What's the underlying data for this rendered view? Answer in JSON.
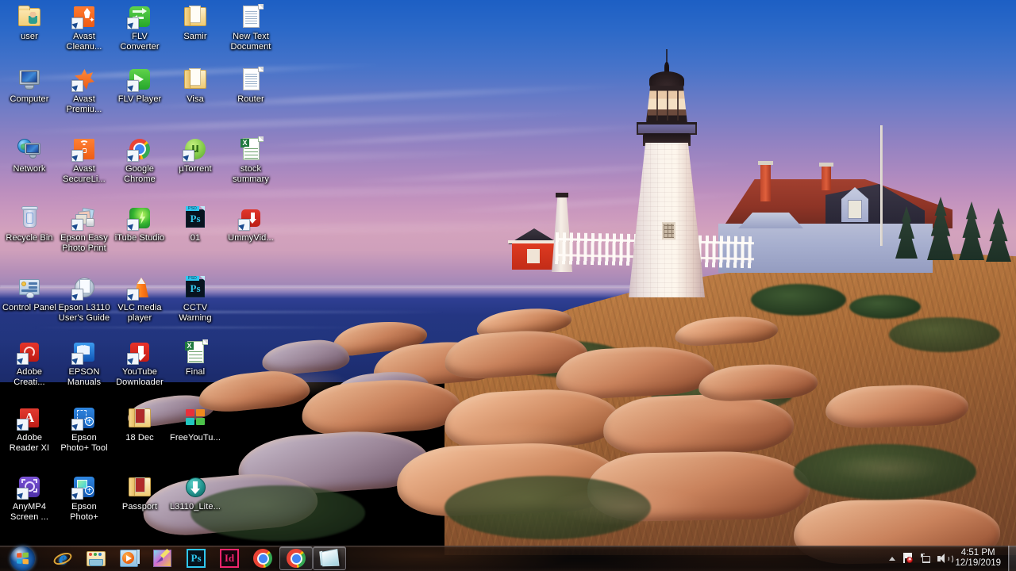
{
  "desktop": {
    "wallpaper_name": "pemaquid-point-lighthouse",
    "icons": [
      {
        "label": "user",
        "icon": "user-folder-icon",
        "col": 0,
        "row": 0
      },
      {
        "label": "Avast Cleanu...",
        "icon": "avast-cleanup-icon",
        "col": 1,
        "row": 0
      },
      {
        "label": "FLV Converter",
        "icon": "flv-converter-icon",
        "col": 2,
        "row": 0
      },
      {
        "label": "Samir",
        "icon": "folder-icon",
        "col": 3,
        "row": 0
      },
      {
        "label": "New Text Document",
        "icon": "text-document-icon",
        "col": 4,
        "row": 0
      },
      {
        "label": "Computer",
        "icon": "computer-icon",
        "col": 0,
        "row": 1
      },
      {
        "label": "Avast Premiu...",
        "icon": "avast-premium-icon",
        "col": 1,
        "row": 1
      },
      {
        "label": "FLV Player",
        "icon": "flv-player-icon",
        "col": 2,
        "row": 1
      },
      {
        "label": "Visa",
        "icon": "folder-icon",
        "col": 3,
        "row": 1
      },
      {
        "label": "Router",
        "icon": "text-document-icon",
        "col": 4,
        "row": 1
      },
      {
        "label": "Network",
        "icon": "network-icon",
        "col": 0,
        "row": 2
      },
      {
        "label": "Avast SecureLi...",
        "icon": "avast-secureline-icon",
        "col": 1,
        "row": 2
      },
      {
        "label": "Google Chrome",
        "icon": "google-chrome-icon",
        "col": 2,
        "row": 2
      },
      {
        "label": "µTorrent",
        "icon": "utorrent-icon",
        "col": 3,
        "row": 2
      },
      {
        "label": "stock summary",
        "icon": "excel-spreadsheet-icon",
        "col": 4,
        "row": 2
      },
      {
        "label": "Recycle Bin",
        "icon": "recycle-bin-icon",
        "col": 0,
        "row": 3
      },
      {
        "label": "Epson Easy Photo Print",
        "icon": "epson-easy-photo-print-icon",
        "col": 1,
        "row": 3
      },
      {
        "label": "iTube Studio",
        "icon": "itube-studio-icon",
        "col": 2,
        "row": 3
      },
      {
        "label": "01",
        "icon": "photoshop-psd-file-icon",
        "col": 3,
        "row": 3
      },
      {
        "label": "UmmyVid...",
        "icon": "ummy-video-downloader-icon",
        "col": 4,
        "row": 3
      },
      {
        "label": "Control Panel",
        "icon": "control-panel-icon",
        "col": 0,
        "row": 4
      },
      {
        "label": "Epson L3110 User's Guide",
        "icon": "epson-users-guide-icon",
        "col": 1,
        "row": 4
      },
      {
        "label": "VLC media player",
        "icon": "vlc-media-player-icon",
        "col": 2,
        "row": 4
      },
      {
        "label": "CCTV Warning",
        "icon": "photoshop-psd-file-icon",
        "col": 3,
        "row": 4
      },
      {
        "label": "Adobe Creati...",
        "icon": "adobe-creative-cloud-icon",
        "col": 0,
        "row": 5
      },
      {
        "label": "EPSON Manuals",
        "icon": "epson-manuals-icon",
        "col": 1,
        "row": 5
      },
      {
        "label": "YouTube Downloader",
        "icon": "youtube-downloader-icon",
        "col": 2,
        "row": 5
      },
      {
        "label": "Final",
        "icon": "excel-spreadsheet-icon",
        "col": 3,
        "row": 5
      },
      {
        "label": "Adobe Reader XI",
        "icon": "adobe-reader-icon",
        "col": 0,
        "row": 6
      },
      {
        "label": "Epson Photo+ Tool",
        "icon": "epson-photo-plus-tool-icon",
        "col": 1,
        "row": 6
      },
      {
        "label": "18 Dec",
        "icon": "folder-open-icon",
        "col": 2,
        "row": 6
      },
      {
        "label": "FreeYouTu...",
        "icon": "free-youtube-icon",
        "col": 3,
        "row": 6
      },
      {
        "label": "AnyMP4 Screen ...",
        "icon": "anymp4-screen-recorder-icon",
        "col": 0,
        "row": 7
      },
      {
        "label": "Epson Photo+",
        "icon": "epson-photo-plus-icon",
        "col": 1,
        "row": 7
      },
      {
        "label": "Passport",
        "icon": "folder-open-icon",
        "col": 2,
        "row": 7
      },
      {
        "label": "L3110_Lite...",
        "icon": "download-installer-icon",
        "col": 3,
        "row": 7
      }
    ]
  },
  "taskbar": {
    "start_button_label": "Start",
    "items": [
      {
        "name": "internet-explorer",
        "label": "Internet Explorer",
        "running": false
      },
      {
        "name": "windows-explorer",
        "label": "Windows Explorer",
        "running": false
      },
      {
        "name": "windows-media-player",
        "label": "Windows Media Player",
        "running": false
      },
      {
        "name": "paint",
        "label": "Paint",
        "running": false
      },
      {
        "name": "adobe-photoshop",
        "label": "Adobe Photoshop",
        "running": false
      },
      {
        "name": "adobe-indesign",
        "label": "Adobe InDesign",
        "running": false
      },
      {
        "name": "google-chrome",
        "label": "Google Chrome",
        "running": false
      },
      {
        "name": "google-chrome-window",
        "label": "Google Chrome",
        "running": true
      },
      {
        "name": "notepad-window",
        "label": "Notepad",
        "running": true
      }
    ],
    "tray": {
      "show_hidden_icons_label": "Show hidden icons",
      "action_center_label": "Action Center",
      "network_label": "Network",
      "volume_label": "Speakers",
      "time": "4:51 PM",
      "date": "12/19/2019",
      "show_desktop_label": "Show desktop"
    }
  },
  "colors": {
    "sky_top": "#1d5fc4",
    "sky_mid": "#a888c0",
    "sky_low": "#d3a2bd",
    "sea": "#22357e",
    "rock_warm": "#c9825c",
    "grass": "#bd7d45",
    "taskbar": "#0a0808",
    "start_orb": "#1553a0",
    "label_text": "#ffffff"
  }
}
